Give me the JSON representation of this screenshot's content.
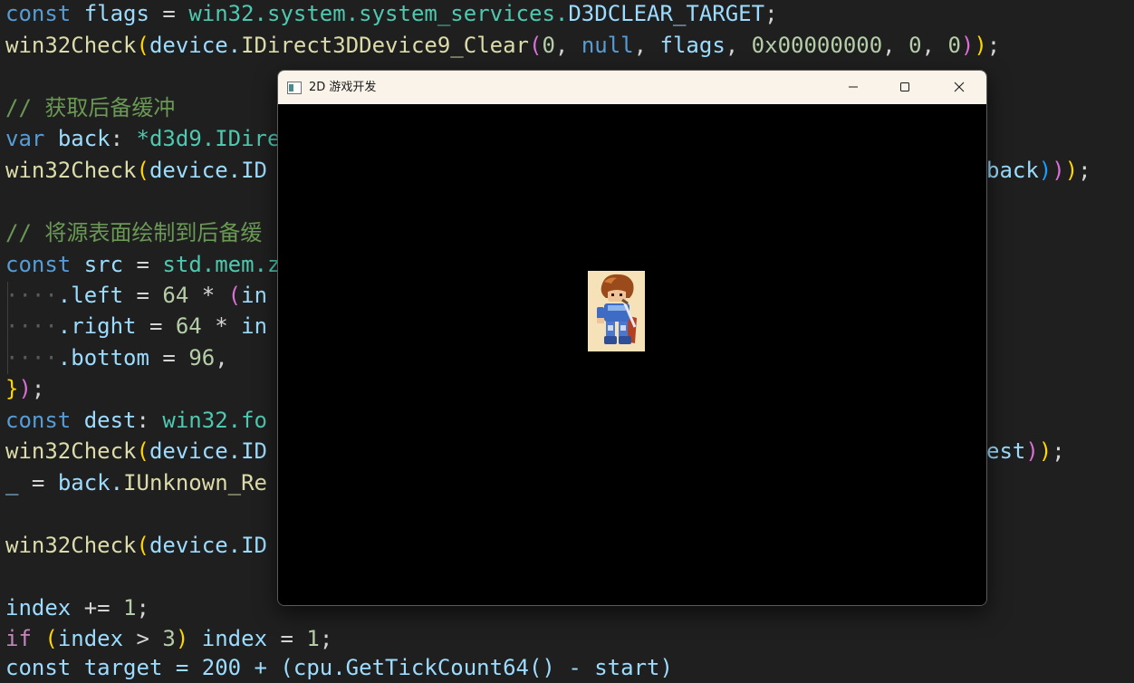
{
  "editor": {
    "line1": {
      "kw": "const",
      "name": "flags",
      "eq": " = ",
      "path": "win32.system.system_services.",
      "const": "D3DCLEAR_TARGET",
      "end": ";"
    },
    "line2": {
      "fn": "win32Check",
      "open": "(",
      "obj": "device.",
      "method": "IDirect3DDevice9_Clear",
      "open2": "(",
      "a1": "0",
      "sep": ", ",
      "a2": "null",
      "a3": "flags",
      "a4": "0x00000000",
      "a5": "0",
      "a6": "0",
      "close2": ")",
      "close": ")",
      "end": ";"
    },
    "line3_comment": "// 获取后备缓冲",
    "line4": {
      "kw": "var",
      "name": "back",
      "colon": ": ",
      "type": "*d3d9.IDire"
    },
    "line5": {
      "fn": "win32Check",
      "open": "(",
      "obj": "device.ID",
      "tail": "back",
      "close3": ")",
      "close2": ")",
      "close": ")",
      "end": ";"
    },
    "line6_comment": "// 将源表面绘制到后备缓",
    "line7": {
      "kw": "const",
      "name": "src",
      "eq": " = ",
      "path": "std.mem.z"
    },
    "line8": {
      "ws": "····",
      "field": ".left",
      "eq": " = ",
      "num": "64",
      "op": " * ",
      "paren": "(",
      "rest": "in"
    },
    "line9": {
      "ws": "····",
      "field": ".right",
      "eq": " = ",
      "num": "64",
      "op": " * ",
      "rest": "in"
    },
    "line10": {
      "ws": "····",
      "field": ".bottom",
      "eq": " = ",
      "num": "96",
      "end": ","
    },
    "line11": {
      "brace": "}",
      "paren": ")",
      "end": ";"
    },
    "line12": {
      "kw": "const",
      "name": "dest",
      "colon": ": ",
      "path": "win32.fo"
    },
    "line13": {
      "fn": "win32Check",
      "open": "(",
      "obj": "device.ID",
      "tail": "est",
      "close": ")",
      "close2": ")",
      "end": ";"
    },
    "line14": {
      "under": "_",
      "eq": " = ",
      "obj": "back.",
      "method": "IUnknown_Re"
    },
    "line16": {
      "fn": "win32Check",
      "open": "(",
      "obj": "device.ID"
    },
    "line18": {
      "name": "index",
      "op": " += ",
      "num": "1",
      "end": ";"
    },
    "line19": {
      "kw": "if",
      "open": " (",
      "name": "index",
      "op": " > ",
      "num": "3",
      "close": ")",
      "name2": " index",
      "eq": " = ",
      "num2": "1",
      "end": ";"
    },
    "line20": {
      "partial": "const target = 200 + (cpu.GetTickCount64() - start)"
    }
  },
  "window": {
    "title": "2D 游戏开发",
    "minimize_icon": "minimize-icon",
    "maximize_icon": "maximize-icon",
    "close_icon": "close-icon",
    "background": "#000000",
    "titlebar_color": "#f9f3ea"
  },
  "colors": {
    "editor_bg": "#1f1f1f",
    "keyword": "#569cd6",
    "variable": "#9cdcfe",
    "function": "#dcdcaa",
    "type": "#4ec9b0",
    "number": "#b5cea8",
    "comment": "#6a9955"
  }
}
